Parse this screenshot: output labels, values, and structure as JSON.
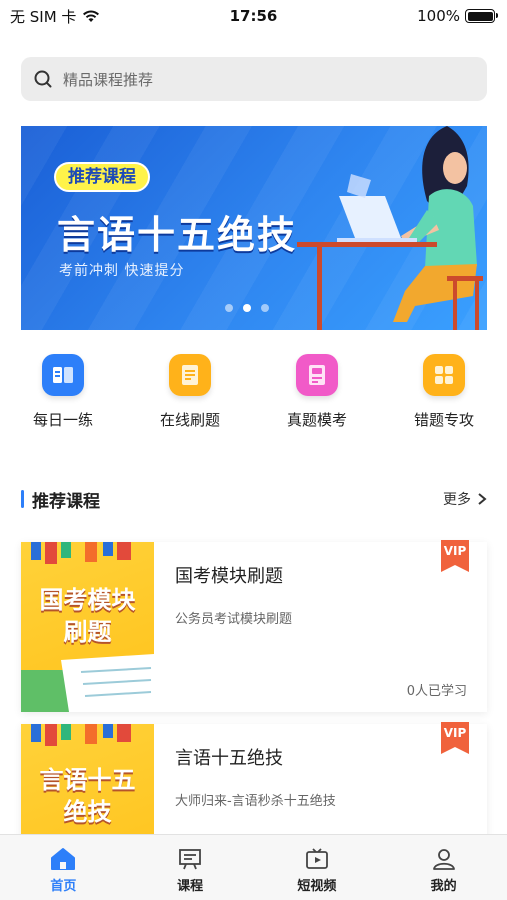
{
  "status_bar": {
    "carrier": "无 SIM 卡",
    "time": "17:56",
    "battery": "100%"
  },
  "search": {
    "placeholder": "精品课程推荐"
  },
  "banner": {
    "tag": "推荐课程",
    "title": "言语十五绝技",
    "subtitle": "考前冲刺  快速提分",
    "active_dot": 1
  },
  "quick_entries": [
    {
      "label": "每日一练",
      "icon": "book-icon",
      "color": "#2d7ff9"
    },
    {
      "label": "在线刷题",
      "icon": "document-icon",
      "color": "#ffb21a"
    },
    {
      "label": "真题模考",
      "icon": "exam-icon",
      "color": "#f15ac8"
    },
    {
      "label": "错题专攻",
      "icon": "grid-icon",
      "color": "#ffb21a"
    }
  ],
  "section": {
    "title": "推荐课程",
    "more": "更多"
  },
  "courses": [
    {
      "title": "国考模块刷题",
      "desc": "公务员考试模块刷题",
      "learners": "0人已学习",
      "badge": "VIP",
      "thumb_line1": "国考模块",
      "thumb_line2": "刷题"
    },
    {
      "title": "言语十五绝技",
      "desc": "大师归来-言语秒杀十五绝技",
      "badge": "VIP",
      "thumb_line1": "言语十五",
      "thumb_line2": "绝技"
    }
  ],
  "tab_bar": [
    {
      "label": "首页",
      "icon": "home-icon"
    },
    {
      "label": "课程",
      "icon": "course-icon"
    },
    {
      "label": "短视频",
      "icon": "video-icon"
    },
    {
      "label": "我的",
      "icon": "profile-icon"
    }
  ],
  "colors": {
    "accent": "#2d7ff9",
    "vip": "#f0623c",
    "thumb": "#ffc21a"
  }
}
